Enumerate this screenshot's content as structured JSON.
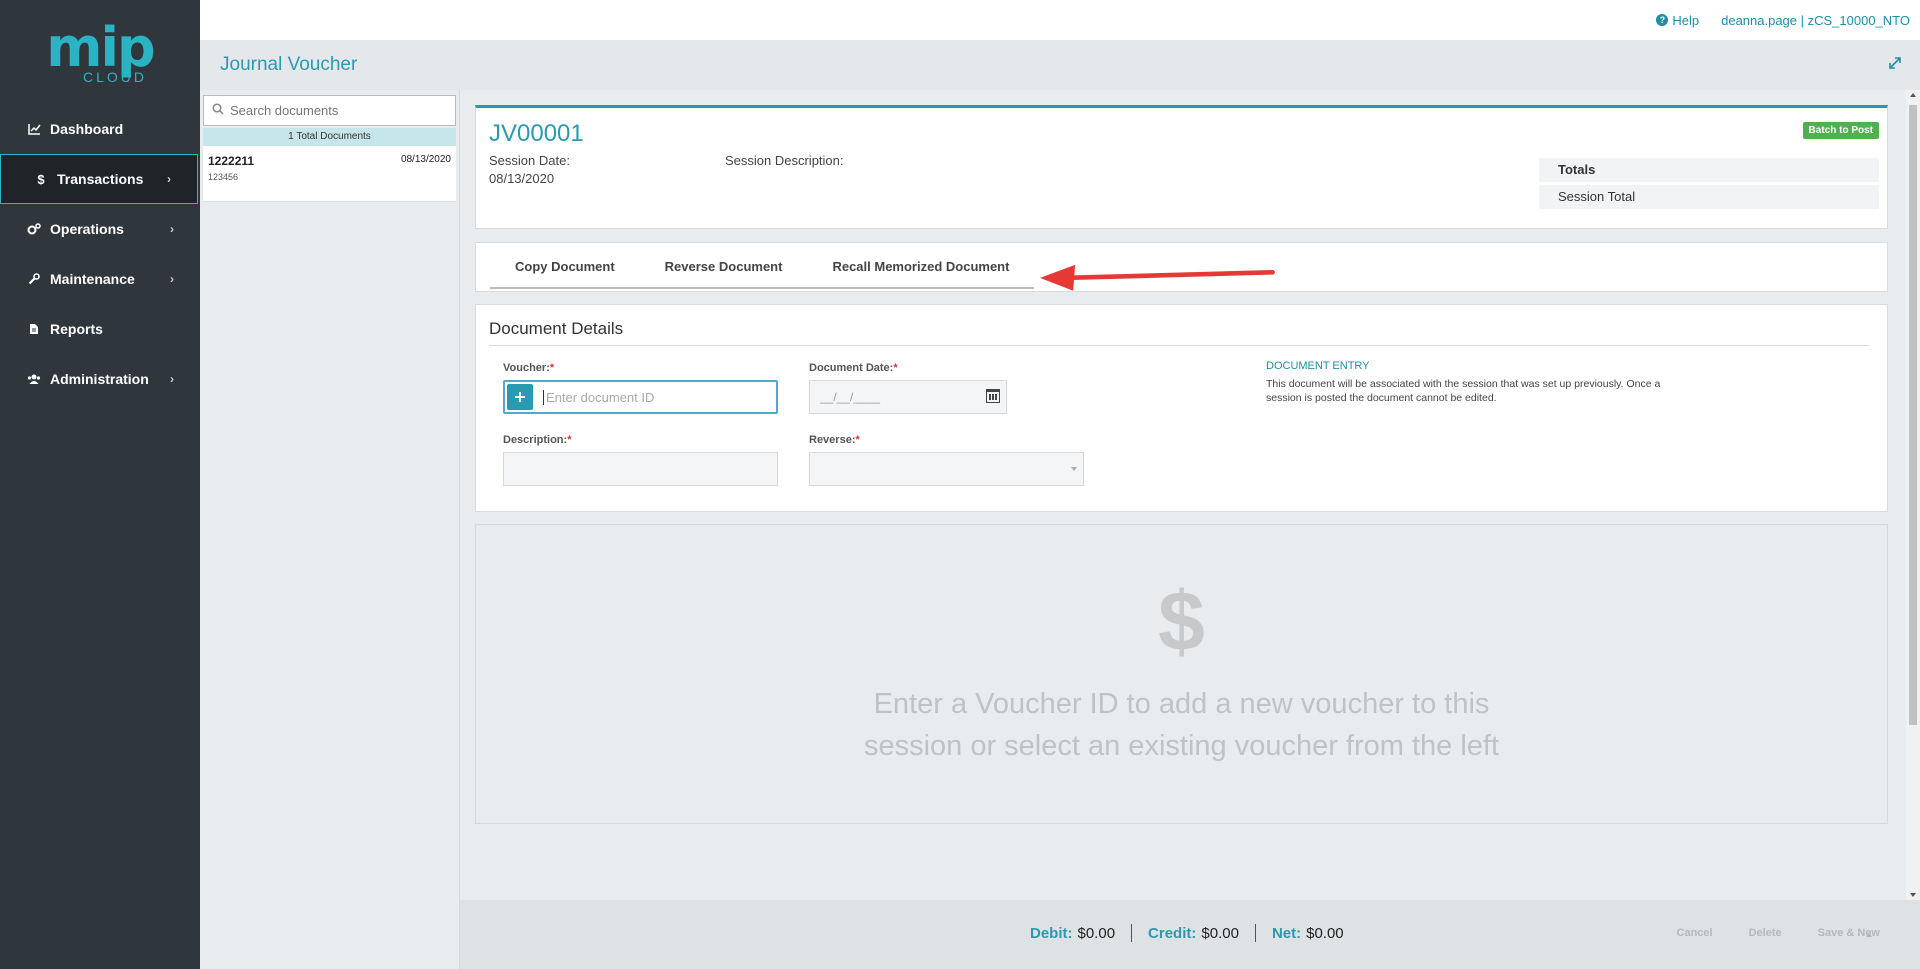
{
  "brand": {
    "logo_main": "mip",
    "logo_sub": "CLOUD"
  },
  "nav": {
    "items": [
      {
        "label": "Dashboard",
        "icon": "chart-line-icon",
        "glyph": "📈",
        "has_chevron": false
      },
      {
        "label": "Transactions",
        "icon": "dollar-icon",
        "glyph": "$",
        "has_chevron": true,
        "active": true
      },
      {
        "label": "Operations",
        "icon": "gears-icon",
        "glyph": "⚙",
        "has_chevron": true
      },
      {
        "label": "Maintenance",
        "icon": "wrench-icon",
        "glyph": "🔧",
        "has_chevron": true
      },
      {
        "label": "Reports",
        "icon": "file-icon",
        "glyph": "📄",
        "has_chevron": false
      },
      {
        "label": "Administration",
        "icon": "users-icon",
        "glyph": "👥",
        "has_chevron": true
      }
    ]
  },
  "header": {
    "help_label": "Help",
    "user_label": "deanna.page | zCS_10000_NTO",
    "page_title": "Journal Voucher"
  },
  "doclist": {
    "search_placeholder": "Search documents",
    "count_label": "1 Total Documents",
    "items": [
      {
        "id": "1222211",
        "date": "08/13/2020",
        "sub": "123456"
      }
    ]
  },
  "session": {
    "jv_id": "JV00001",
    "date_label": "Session Date:",
    "date_value": "08/13/2020",
    "desc_label": "Session Description:",
    "desc_value": "",
    "batch_button": "Batch to Post",
    "totals_header": "Totals",
    "totals_row": "Session Total"
  },
  "actions": {
    "copy": "Copy Document",
    "reverse": "Reverse Document",
    "recall": "Recall Memorized Document"
  },
  "details": {
    "title": "Document Details",
    "voucher_label": "Voucher:",
    "voucher_placeholder": "Enter document ID",
    "doc_date_label": "Document Date:",
    "doc_date_placeholder": "__/__/____",
    "description_label": "Description:",
    "reverse_label": "Reverse:",
    "required_mark": "*",
    "entry_title": "DOCUMENT ENTRY",
    "entry_text": "This document will be associated with the session that was set up previously. Once a session is posted the document cannot be edited."
  },
  "empty_state": {
    "symbol": "$",
    "message": "Enter a Voucher ID to add a new voucher to this session or select an existing voucher from the left"
  },
  "footer": {
    "debit_label": "Debit:",
    "debit_value": "$0.00",
    "credit_label": "Credit:",
    "credit_value": "$0.00",
    "net_label": "Net:",
    "net_value": "$0.00",
    "cancel": "Cancel",
    "delete": "Delete",
    "save_new": "Save & New"
  },
  "colors": {
    "accent": "#2a9ab0",
    "sidebar": "#2f363c",
    "success": "#4fb04d",
    "annotation_arrow": "#e53935"
  }
}
